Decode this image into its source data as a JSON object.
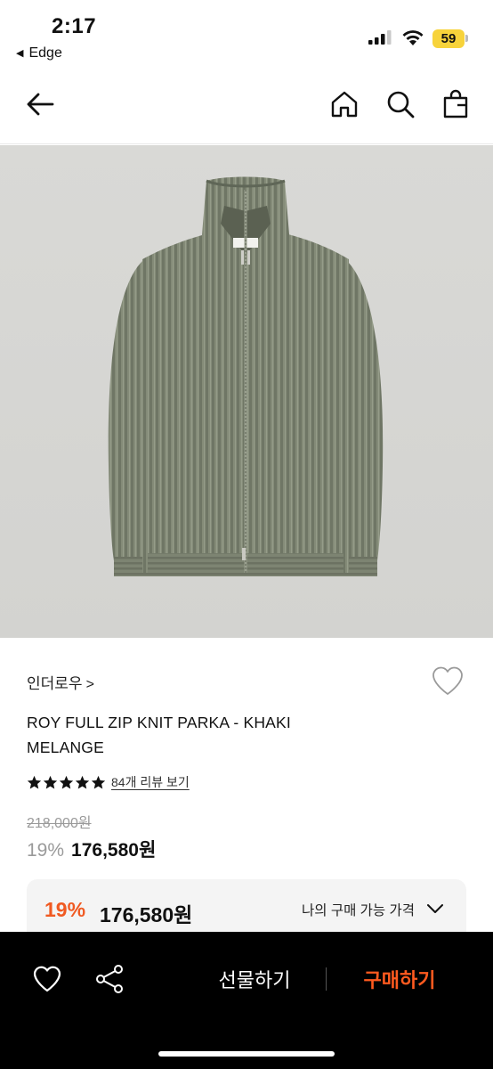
{
  "status_bar": {
    "time": "2:17",
    "back_app": "Edge",
    "battery": "59"
  },
  "nav": {
    "icons": [
      "back-arrow-icon",
      "home-icon",
      "search-icon",
      "shopping-bag-icon"
    ]
  },
  "product": {
    "brand": "인더로우",
    "brand_chevron": ">",
    "title": "ROY FULL ZIP KNIT PARKA - KHAKI MELANGE",
    "rating": 5,
    "review_link": "84개 리뷰 보기",
    "original_price": "218,000원",
    "discount_percent": "19%",
    "sale_price": "176,580원"
  },
  "my_price": {
    "discount_percent": "19%",
    "price": "176,580원",
    "label": "나의 구매 가능 가격"
  },
  "bottom_bar": {
    "gift_label": "선물하기",
    "buy_label": "구매하기"
  },
  "colors": {
    "accent": "#f05a22",
    "buy_text": "#ff5a1f",
    "bottom_bar_bg": "#000000",
    "price_card_bg": "#f4f4f4",
    "battery": "#f7d33b"
  }
}
